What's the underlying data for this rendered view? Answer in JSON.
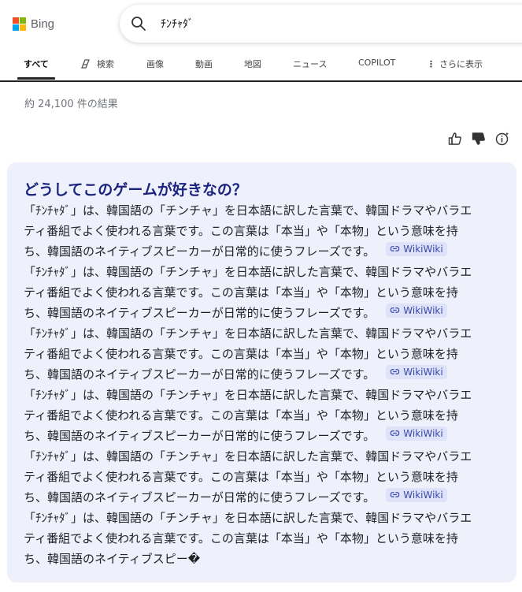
{
  "header": {
    "logo_text": "Bing",
    "search_query": "ﾁﾝﾁｬﾀﾞ"
  },
  "tabs": [
    {
      "label": "すべて"
    },
    {
      "label": "検索"
    },
    {
      "label": "画像"
    },
    {
      "label": "動画"
    },
    {
      "label": "地図"
    },
    {
      "label": "ニュース"
    },
    {
      "label": "COPILOT"
    },
    {
      "label": "さらに表示"
    }
  ],
  "results": {
    "count_text": "約 24,100 件の結果"
  },
  "answer": {
    "title": "どうしてこのゲームが好きなの？",
    "paragraphs": [
      {
        "line1": "「ﾁﾝﾁｬﾀﾞ」は、韓国語の「チンチャ」を日本語に訳した言葉で、韓国ドラマやバラエ",
        "line2": "ティ番組でよく使われる言葉です。この言葉は「本当」や「本物」という意味を持",
        "line3": "ち、韓国語のネイティブスピーカーが日常的に使うフレーズです。",
        "cite": "WikiWiki"
      },
      {
        "line1": "「ﾁﾝﾁｬﾀﾞ」は、韓国語の「チンチャ」を日本語に訳した言葉で、韓国ドラマやバラエ",
        "line2": "ティ番組でよく使われる言葉です。この言葉は「本当」や「本物」という意味を持",
        "line3": "ち、韓国語のネイティブスピーカーが日常的に使うフレーズです。",
        "cite": "WikiWiki"
      },
      {
        "line1": "「ﾁﾝﾁｬﾀﾞ」は、韓国語の「チンチャ」を日本語に訳した言葉で、韓国ドラマやバラエ",
        "line2": "ティ番組でよく使われる言葉です。この言葉は「本当」や「本物」という意味を持",
        "line3": "ち、韓国語のネイティブスピーカーが日常的に使うフレーズです。",
        "cite": "WikiWiki"
      },
      {
        "line1": "「ﾁﾝﾁｬﾀﾞ」は、韓国語の「チンチャ」を日本語に訳した言葉で、韓国ドラマやバラエ",
        "line2": "ティ番組でよく使われる言葉です。この言葉は「本当」や「本物」という意味を持",
        "line3": "ち、韓国語のネイティブスピーカーが日常的に使うフレーズです。",
        "cite": "WikiWiki"
      },
      {
        "line1": "「ﾁﾝﾁｬﾀﾞ」は、韓国語の「チンチャ」を日本語に訳した言葉で、韓国ドラマやバラエ",
        "line2": "ティ番組でよく使われる言葉です。この言葉は「本当」や「本物」という意味を持",
        "line3": "ち、韓国語のネイティブスピーカーが日常的に使うフレーズです。",
        "cite": "WikiWiki"
      }
    ],
    "truncated": {
      "line1": "「ﾁﾝﾁｬﾀﾞ」は、韓国語の「チンチャ」を日本語に訳した言葉で、韓国ドラマやバラエ",
      "line2": "ティ番組でよく使われる言葉です。この言葉は「本当」や「本物」という意味を持",
      "line3": "ち、韓国語のネイティブスピー�"
    }
  },
  "colors": {
    "accent": "#1a237e",
    "card_bg": "#eef1fc",
    "cite_bg": "#dfe3fa",
    "cite_text": "#3949ab"
  }
}
